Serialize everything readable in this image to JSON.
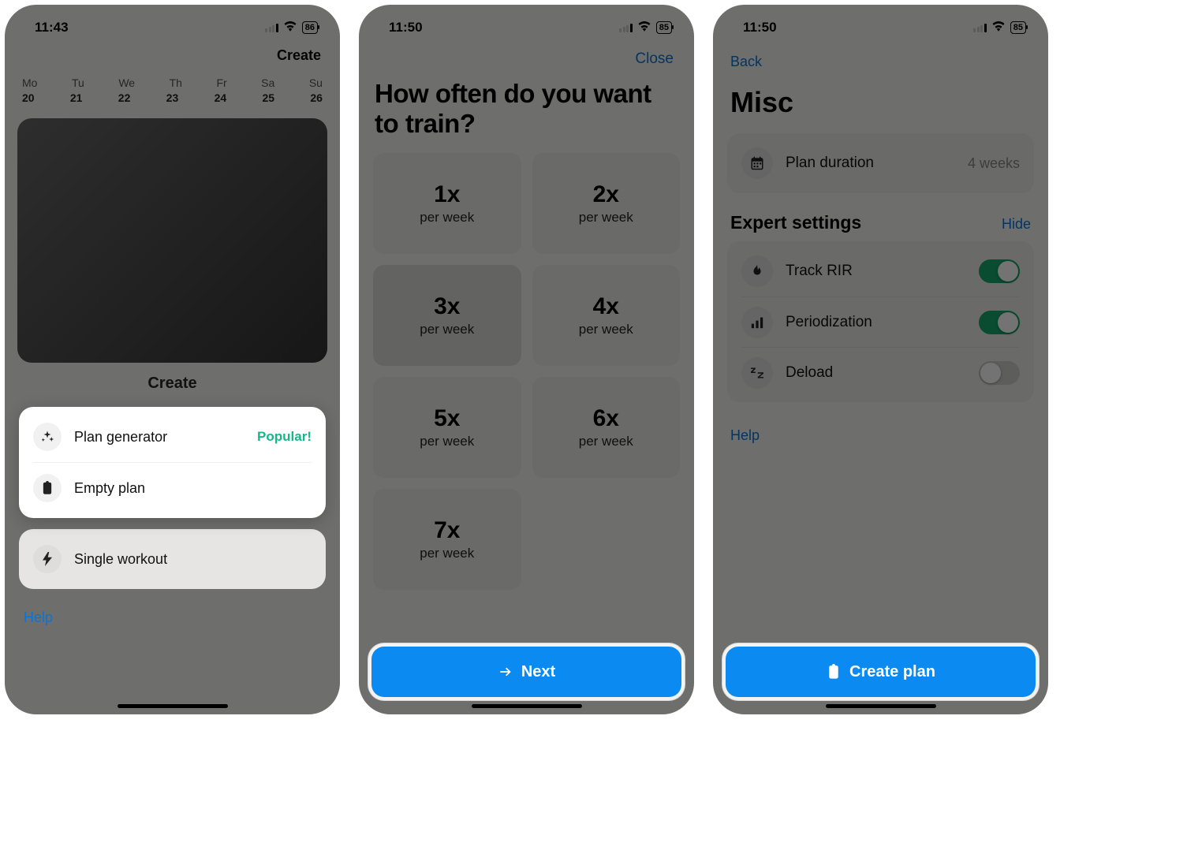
{
  "status": {
    "time1": "11:43",
    "time2": "11:50",
    "time3": "11:50",
    "battery1": "86",
    "battery2": "85",
    "battery3": "85"
  },
  "s1": {
    "create": "Create",
    "days": [
      "Mo",
      "Tu",
      "We",
      "Th",
      "Fr",
      "Sa",
      "Su"
    ],
    "nums": [
      "20",
      "21",
      "22",
      "23",
      "24",
      "25",
      "26"
    ],
    "sheet_title": "Create",
    "plan_gen": "Plan generator",
    "popular": "Popular!",
    "empty_plan": "Empty plan",
    "single_workout": "Single workout",
    "help": "Help"
  },
  "s2": {
    "close": "Close",
    "question": "How often do you want to train?",
    "per_week": "per week",
    "options": [
      "1x",
      "2x",
      "3x",
      "4x",
      "5x",
      "6x",
      "7x"
    ],
    "selected": "3x",
    "next": "Next"
  },
  "s3": {
    "back": "Back",
    "title": "Misc",
    "plan_duration_label": "Plan duration",
    "plan_duration_value": "4 weeks",
    "expert": "Expert settings",
    "hide": "Hide",
    "track_rir": "Track RIR",
    "periodization": "Periodization",
    "deload": "Deload",
    "help": "Help",
    "create_plan": "Create plan"
  }
}
